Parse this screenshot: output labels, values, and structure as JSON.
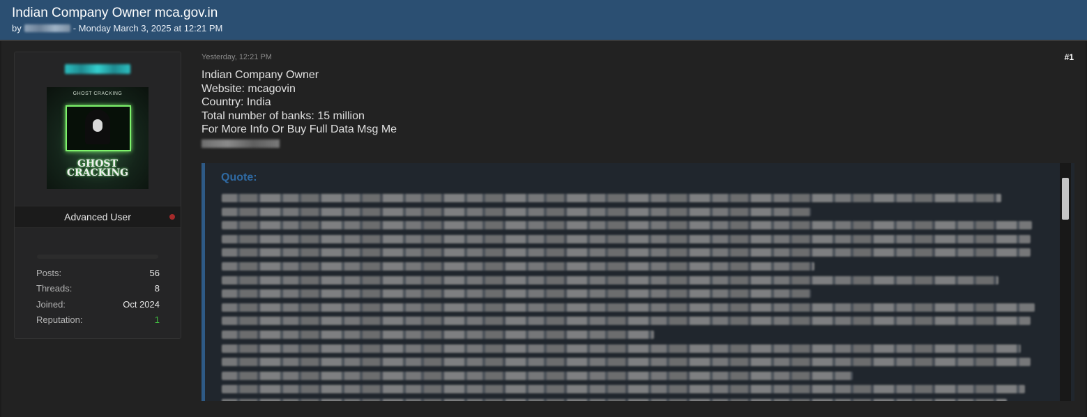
{
  "thread": {
    "title": "Indian Company Owner mca.gov.in",
    "by": "by",
    "date": "- Monday March 3, 2025 at 12:21 PM"
  },
  "user": {
    "avatar_top_text": "GHOST CRACKING",
    "avatar_logo_line1": "GHOST",
    "avatar_logo_line2": "CRACKING",
    "rank": "Advanced User",
    "stats": [
      {
        "label": "Posts:",
        "value": "56"
      },
      {
        "label": "Threads:",
        "value": "8"
      },
      {
        "label": "Joined:",
        "value": "Oct 2024"
      },
      {
        "label": "Reputation:",
        "value": "1"
      }
    ],
    "status_color": "#a52a2a",
    "username_color": "#2bbfc1"
  },
  "post": {
    "timestamp": "Yesterday, 12:21 PM",
    "number": "#1",
    "lines": [
      "Indian Company Owner",
      "Website: mcagovin",
      "Country: India",
      "Total number of banks: 15 million",
      "For More Info Or Buy Full Data Msg Me"
    ],
    "quote_title": "Quote:"
  },
  "colors": {
    "header_bg": "#2b4f72",
    "quote_accent": "#2e5a86",
    "reputation_positive": "#3fb83f"
  }
}
